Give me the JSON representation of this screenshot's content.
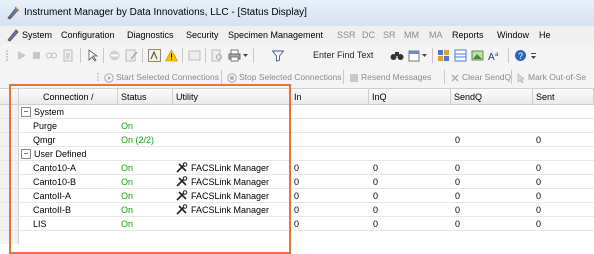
{
  "window": {
    "title": "Instrument Manager by Data Innovations, LLC - [Status Display]"
  },
  "menubar": {
    "items": [
      {
        "label": "System",
        "dim": false
      },
      {
        "label": "Configuration",
        "dim": false
      },
      {
        "label": "Diagnostics",
        "dim": false
      },
      {
        "label": "Security",
        "dim": false
      },
      {
        "label": "Specimen Management",
        "dim": false
      },
      {
        "label": "SSR",
        "dim": true
      },
      {
        "label": "DC",
        "dim": true
      },
      {
        "label": "SR",
        "dim": true
      },
      {
        "label": "MM",
        "dim": true
      },
      {
        "label": "MA",
        "dim": true
      },
      {
        "label": "Reports",
        "dim": false
      },
      {
        "label": "Window",
        "dim": false
      },
      {
        "label": "He",
        "dim": false
      }
    ]
  },
  "toolbar": {
    "find_text_label": "Enter Find Text"
  },
  "actions": {
    "start_selected": "Start Selected Connections",
    "stop_selected": "Stop Selected Connections",
    "resend": "Resend Messages",
    "clear_sendq": "Clear SendQ",
    "mark_out_of_service": "Mark Out-of-Se"
  },
  "grid": {
    "columns": [
      "Connection /",
      "Status",
      "Utility",
      "In",
      "InQ",
      "SendQ",
      "Sent"
    ],
    "groups": [
      {
        "name": "System",
        "toggle": "−",
        "rows": [
          {
            "connection": "Purge",
            "status": "On",
            "utility": "",
            "in": "",
            "inq": "",
            "sendq": "",
            "sent": ""
          },
          {
            "connection": "Qmgr",
            "status": "On (2/2)",
            "utility": "",
            "in": "",
            "inq": "",
            "sendq": "0",
            "sent": "0"
          }
        ]
      },
      {
        "name": "User Defined",
        "toggle": "−",
        "rows": [
          {
            "connection": "Canto10-A",
            "status": "On",
            "utility": "FACSLink Manager",
            "in": "0",
            "inq": "0",
            "sendq": "0",
            "sent": "0"
          },
          {
            "connection": "Canto10-B",
            "status": "On",
            "utility": "FACSLink Manager",
            "in": "0",
            "inq": "0",
            "sendq": "0",
            "sent": "0"
          },
          {
            "connection": "CantoII-A",
            "status": "On",
            "utility": "FACSLink Manager",
            "in": "0",
            "inq": "0",
            "sendq": "0",
            "sent": "0"
          },
          {
            "connection": "CantoII-B",
            "status": "On",
            "utility": "FACSLink Manager",
            "in": "0",
            "inq": "0",
            "sendq": "0",
            "sent": "0"
          },
          {
            "connection": "LIS",
            "status": "On",
            "utility": "",
            "in": "0",
            "inq": "0",
            "sendq": "0",
            "sent": "0"
          }
        ]
      }
    ]
  },
  "colors": {
    "status_on": "#0aa60a",
    "highlight_box": "#e8733a"
  }
}
